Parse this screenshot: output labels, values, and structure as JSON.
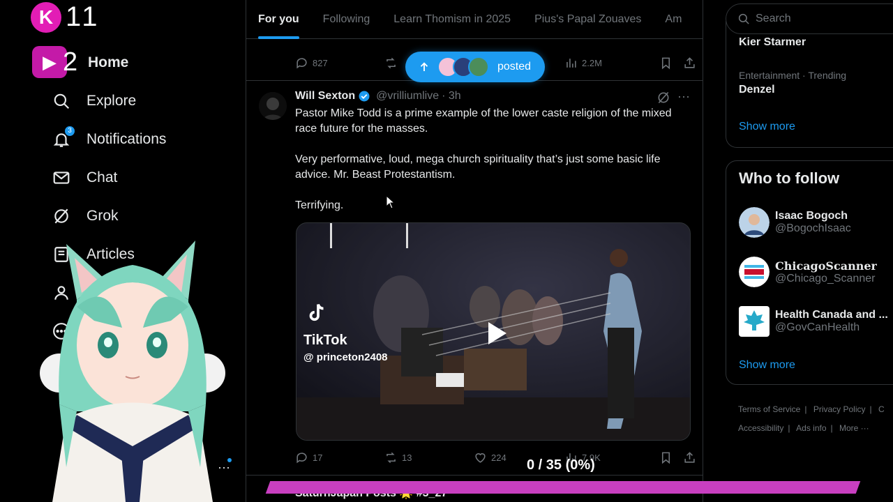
{
  "stream": {
    "counter1": "11",
    "counter2": "2"
  },
  "nav": {
    "home": "Home",
    "explore": "Explore",
    "notifications": "Notifications",
    "notifications_badge": "3",
    "chat": "Chat",
    "grok": "Grok",
    "articles": "Articles"
  },
  "tabs": [
    "For you",
    "Following",
    "Learn Thomism in 2025",
    "Pius's Papal Zouaves",
    "Am"
  ],
  "prev_tweet": {
    "replies": "827",
    "views": "2.2M"
  },
  "posted_pill": {
    "label": "posted"
  },
  "tweet": {
    "name": "Will Sexton",
    "handle": "@vrilliumlive",
    "time": "· 3h",
    "paragraphs": [
      "Pastor Mike Todd is a prime example of the lower caste religion of the mixed race future for the masses.",
      "Very performative, loud, mega church spirituality that’s just some basic life advice. Mr. Beast Protestantism.",
      "Terrifying."
    ],
    "media": {
      "tiktok_label": "TikTok",
      "tiktok_user": "@ princeton2408"
    },
    "replies": "17",
    "reposts": "13",
    "likes": "224",
    "views": "7.9K"
  },
  "next_tweet_partial": "SaturnJapan Posts 🌟 #3_27",
  "progress": {
    "text": "0 / 35 (0%)",
    "fraction": 0
  },
  "search": {
    "placeholder": "Search"
  },
  "trends": {
    "item1_title": "Kier Starmer",
    "item2_category": "Entertainment · Trending",
    "item2_title": "Denzel",
    "show_more": "Show more"
  },
  "who_to_follow": {
    "heading": "Who to follow",
    "accounts": [
      {
        "name": "Isaac Bogoch",
        "handle": "@BogochIsaac"
      },
      {
        "name": "ChicagoScanner",
        "handle": "@Chicago_Scanner"
      },
      {
        "name": "Health Canada and ...",
        "handle": "@GovCanHealth"
      }
    ],
    "show_more": "Show more"
  },
  "footer": {
    "terms": "Terms of Service",
    "privacy": "Privacy Policy",
    "c": "C",
    "accessibility": "Accessibility",
    "ads": "Ads info",
    "more": "More ···"
  },
  "colors": {
    "accent": "#1d9bf0",
    "background": "#000000",
    "stream_pink": "#e21db5"
  }
}
